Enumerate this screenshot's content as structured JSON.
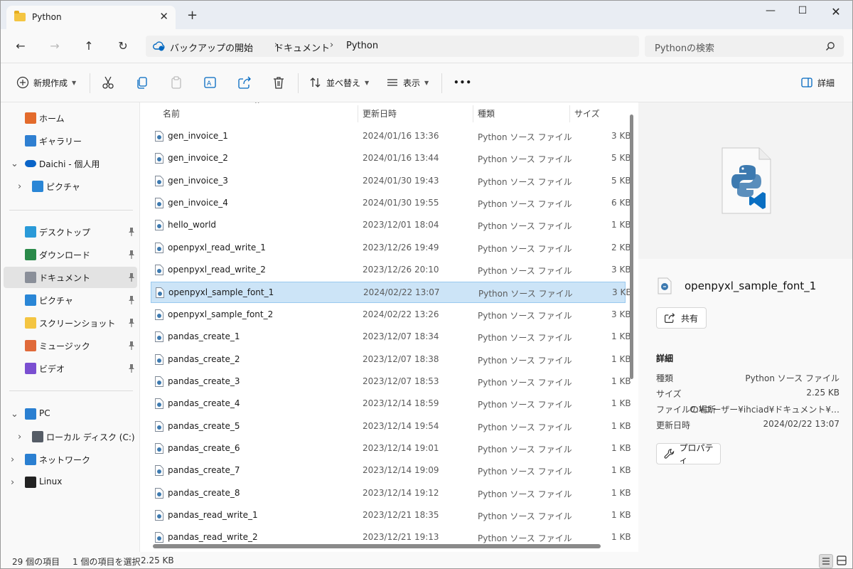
{
  "tab": {
    "title": "Python"
  },
  "address": {
    "crumbs": [
      "バックアップの開始",
      "ドキュメント",
      "Python"
    ],
    "sep": "›"
  },
  "search": {
    "placeholder": "Pythonの検索"
  },
  "toolbar": {
    "new_label": "新規作成",
    "sort_label": "並べ替え",
    "view_label": "表示",
    "more_label": "•••",
    "details_label": "詳細"
  },
  "sidebar": {
    "items": [
      {
        "label": "ホーム",
        "icon": "home-icon"
      },
      {
        "label": "ギャラリー",
        "icon": "gallery-icon"
      },
      {
        "label": "Daichi - 個人用",
        "icon": "onedrive-cloud-icon"
      },
      {
        "label": "ピクチャ",
        "icon": "pictures-icon"
      },
      {
        "label": "デスクトップ",
        "icon": "desktop-icon"
      },
      {
        "label": "ダウンロード",
        "icon": "download-icon"
      },
      {
        "label": "ドキュメント",
        "icon": "documents-icon"
      },
      {
        "label": "ピクチャ",
        "icon": "pictures-icon"
      },
      {
        "label": "スクリーンショット",
        "icon": "folder-icon"
      },
      {
        "label": "ミュージック",
        "icon": "music-icon"
      },
      {
        "label": "ビデオ",
        "icon": "video-icon"
      },
      {
        "label": "PC",
        "icon": "pc-icon"
      },
      {
        "label": "ローカル ディスク (C:)",
        "icon": "disk-icon"
      },
      {
        "label": "ネットワーク",
        "icon": "network-icon"
      },
      {
        "label": "Linux",
        "icon": "linux-icon"
      }
    ]
  },
  "columns": {
    "name": "名前",
    "date": "更新日時",
    "type": "種類",
    "size": "サイズ"
  },
  "files": [
    {
      "name": "gen_invoice_1",
      "date": "2024/01/16 13:36",
      "type": "Python ソース ファイル",
      "size": "3 KB"
    },
    {
      "name": "gen_invoice_2",
      "date": "2024/01/16 13:44",
      "type": "Python ソース ファイル",
      "size": "5 KB"
    },
    {
      "name": "gen_invoice_3",
      "date": "2024/01/30 19:43",
      "type": "Python ソース ファイル",
      "size": "5 KB"
    },
    {
      "name": "gen_invoice_4",
      "date": "2024/01/30 19:55",
      "type": "Python ソース ファイル",
      "size": "6 KB"
    },
    {
      "name": "hello_world",
      "date": "2023/12/01 18:04",
      "type": "Python ソース ファイル",
      "size": "1 KB"
    },
    {
      "name": "openpyxl_read_write_1",
      "date": "2023/12/26 19:49",
      "type": "Python ソース ファイル",
      "size": "2 KB"
    },
    {
      "name": "openpyxl_read_write_2",
      "date": "2023/12/26 20:10",
      "type": "Python ソース ファイル",
      "size": "3 KB"
    },
    {
      "name": "openpyxl_sample_font_1",
      "date": "2024/02/22 13:07",
      "type": "Python ソース ファイル",
      "size": "3 KB",
      "selected": true
    },
    {
      "name": "openpyxl_sample_font_2",
      "date": "2024/02/22 13:26",
      "type": "Python ソース ファイル",
      "size": "3 KB"
    },
    {
      "name": "pandas_create_1",
      "date": "2023/12/07 18:34",
      "type": "Python ソース ファイル",
      "size": "1 KB"
    },
    {
      "name": "pandas_create_2",
      "date": "2023/12/07 18:38",
      "type": "Python ソース ファイル",
      "size": "1 KB"
    },
    {
      "name": "pandas_create_3",
      "date": "2023/12/07 18:53",
      "type": "Python ソース ファイル",
      "size": "1 KB"
    },
    {
      "name": "pandas_create_4",
      "date": "2023/12/14 18:59",
      "type": "Python ソース ファイル",
      "size": "1 KB"
    },
    {
      "name": "pandas_create_5",
      "date": "2023/12/14 19:54",
      "type": "Python ソース ファイル",
      "size": "1 KB"
    },
    {
      "name": "pandas_create_6",
      "date": "2023/12/14 19:01",
      "type": "Python ソース ファイル",
      "size": "1 KB"
    },
    {
      "name": "pandas_create_7",
      "date": "2023/12/14 19:09",
      "type": "Python ソース ファイル",
      "size": "1 KB"
    },
    {
      "name": "pandas_create_8",
      "date": "2023/12/14 19:12",
      "type": "Python ソース ファイル",
      "size": "1 KB"
    },
    {
      "name": "pandas_read_write_1",
      "date": "2023/12/21 18:35",
      "type": "Python ソース ファイル",
      "size": "1 KB"
    },
    {
      "name": "pandas_read_write_2",
      "date": "2023/12/21 19:13",
      "type": "Python ソース ファイル",
      "size": "1 KB"
    }
  ],
  "details": {
    "name": "openpyxl_sample_font_1",
    "share_label": "共有",
    "section_label": "詳細",
    "props": [
      {
        "key": "種類",
        "value": "Python ソース ファイル"
      },
      {
        "key": "サイズ",
        "value": "2.25 KB"
      },
      {
        "key": "ファイルの場所",
        "value": "C:¥ユーザー¥ihciad¥ドキュメント¥…"
      },
      {
        "key": "更新日時",
        "value": "2024/02/22 13:07"
      }
    ],
    "properties_label": "プロパティ"
  },
  "status": {
    "count": "29 個の項目",
    "selection": "1 個の項目を選択",
    "size": "2.25 KB"
  },
  "colors": {
    "accent": "#0067c0",
    "selected_row": "#cce4f7",
    "python_blue": "#3d7ab0",
    "python_yellow": "#f2c744"
  }
}
